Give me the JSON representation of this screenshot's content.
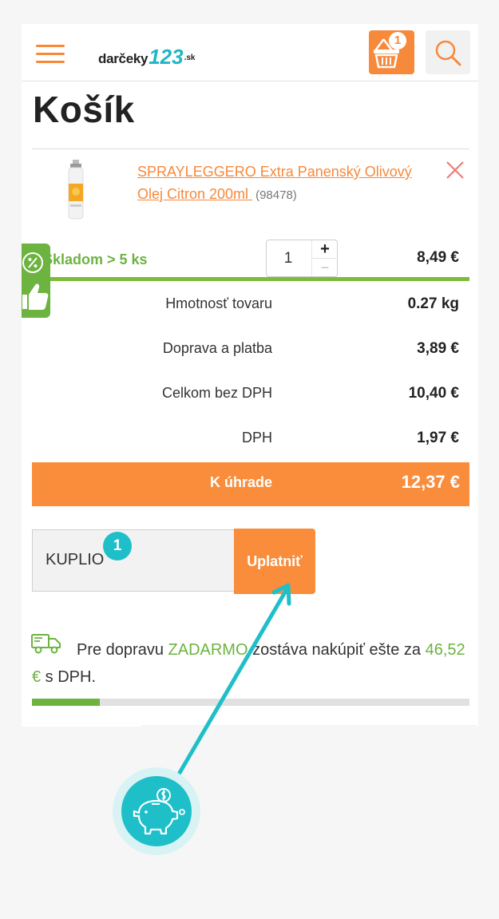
{
  "header": {
    "logo": {
      "word": "darčeky",
      "number": "123",
      "tld": ".sk"
    },
    "cart_count": "1"
  },
  "page_title": "Košík",
  "product": {
    "name": "SPRAYLEGGERO Extra Panenský Olivový Olej Citron 200ml",
    "code": "(98478)",
    "stock": "Skladom > 5 ks",
    "quantity": "1",
    "qty_plus": "+",
    "qty_minus": "−",
    "price": "8,49 €"
  },
  "side_badge": {
    "symbol": "%"
  },
  "summary": [
    {
      "label": "Hmotnosť tovaru",
      "value": "0.27 kg"
    },
    {
      "label": "Doprava a platba",
      "value": "3,89 €"
    },
    {
      "label": "Celkom bez DPH",
      "value": "10,40 €"
    },
    {
      "label": "DPH",
      "value": "1,97 €"
    }
  ],
  "total": {
    "label": "K úhrade",
    "value": "12,37 €"
  },
  "coupon": {
    "value": "KUPLIO",
    "button": "Uplatniť"
  },
  "shipping": {
    "prefix": "Pre dopravu ",
    "highlight": "ZADARMO",
    "middle": " zostáva nakúpiť ešte za ",
    "amount": "46,52 €",
    "suffix": " s DPH.",
    "progress": 0.155
  },
  "step_badge": "1",
  "colors": {
    "accent": "#f7893b",
    "green": "#6cb33f",
    "teal": "#1fbfc9"
  },
  "icons": [
    "hamburger-icon",
    "basket-icon",
    "search-icon",
    "close-icon",
    "percent-icon",
    "thumbs-up-icon",
    "truck-icon",
    "piggy-bank-icon"
  ]
}
